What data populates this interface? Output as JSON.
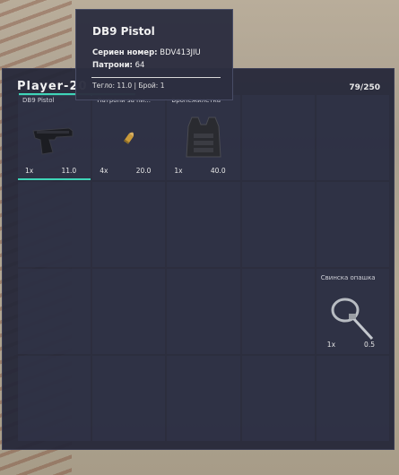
{
  "player": {
    "name": "Player-20",
    "capacity": "79/250",
    "accent": "#3fd5b8"
  },
  "slots": [
    {
      "label": "DB9 Pistol",
      "qty": "1x",
      "weight": "11.0",
      "icon": "pistol-icon"
    },
    {
      "label": "Патрони за пи...",
      "qty": "4x",
      "weight": "20.0",
      "icon": "ammo-icon"
    },
    {
      "label": "Бронежилетка",
      "qty": "1x",
      "weight": "40.0",
      "icon": "body-armor-icon"
    },
    {
      "label": "Свинска опашка",
      "qty": "1x",
      "weight": "0.5",
      "icon": "zip-tie-icon"
    }
  ],
  "tooltip": {
    "title": "DB9 Pistol",
    "serial_key": "Сериен номер:",
    "serial_val": "BDV413JIU",
    "ammo_key": "Патрони:",
    "ammo_val": "64",
    "footer": "Тегло: 11.0 | Брой: 1"
  }
}
